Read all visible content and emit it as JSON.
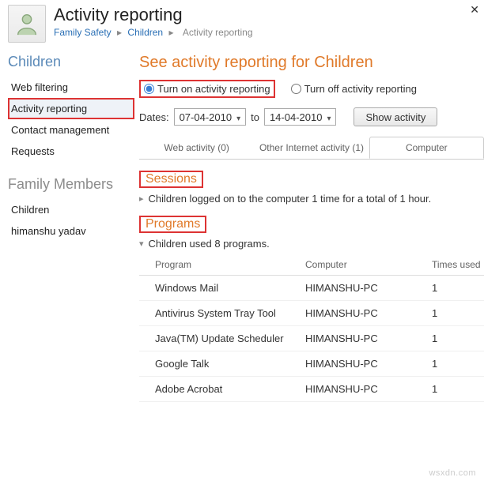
{
  "header": {
    "title": "Activity reporting",
    "breadcrumb": {
      "a": "Family Safety",
      "b": "Children",
      "c": "Activity reporting"
    }
  },
  "sidebar": {
    "heading1": "Children",
    "items": [
      "Web filtering",
      "Activity reporting",
      "Contact management",
      "Requests"
    ],
    "heading2": "Family Members",
    "members": [
      "Children",
      "himanshu yadav"
    ]
  },
  "main": {
    "title": "See activity reporting for Children",
    "radio_on": "Turn on activity reporting",
    "radio_off": "Turn off activity reporting",
    "dates_label": "Dates:",
    "date_from": "07-04-2010",
    "date_to_label": "to",
    "date_to": "14-04-2010",
    "show_btn": "Show activity",
    "tabs": {
      "web": "Web activity (0)",
      "other": "Other Internet activity (1)",
      "comp": "Computer"
    },
    "sessions_title": "Sessions",
    "sessions_text": "Children logged on to the computer 1 time for a total of 1 hour.",
    "programs_title": "Programs",
    "programs_text": "Children used 8 programs.",
    "cols": {
      "prog": "Program",
      "comp": "Computer",
      "times": "Times used"
    },
    "rows": [
      {
        "prog": "Windows Mail",
        "comp": "HIMANSHU-PC",
        "times": "1"
      },
      {
        "prog": "Antivirus System Tray Tool",
        "comp": "HIMANSHU-PC",
        "times": "1"
      },
      {
        "prog": "Java(TM) Update Scheduler",
        "comp": "HIMANSHU-PC",
        "times": "1"
      },
      {
        "prog": "Google Talk",
        "comp": "HIMANSHU-PC",
        "times": "1"
      },
      {
        "prog": "Adobe Acrobat",
        "comp": "HIMANSHU-PC",
        "times": "1"
      }
    ]
  },
  "watermark": "wsxdn.com"
}
